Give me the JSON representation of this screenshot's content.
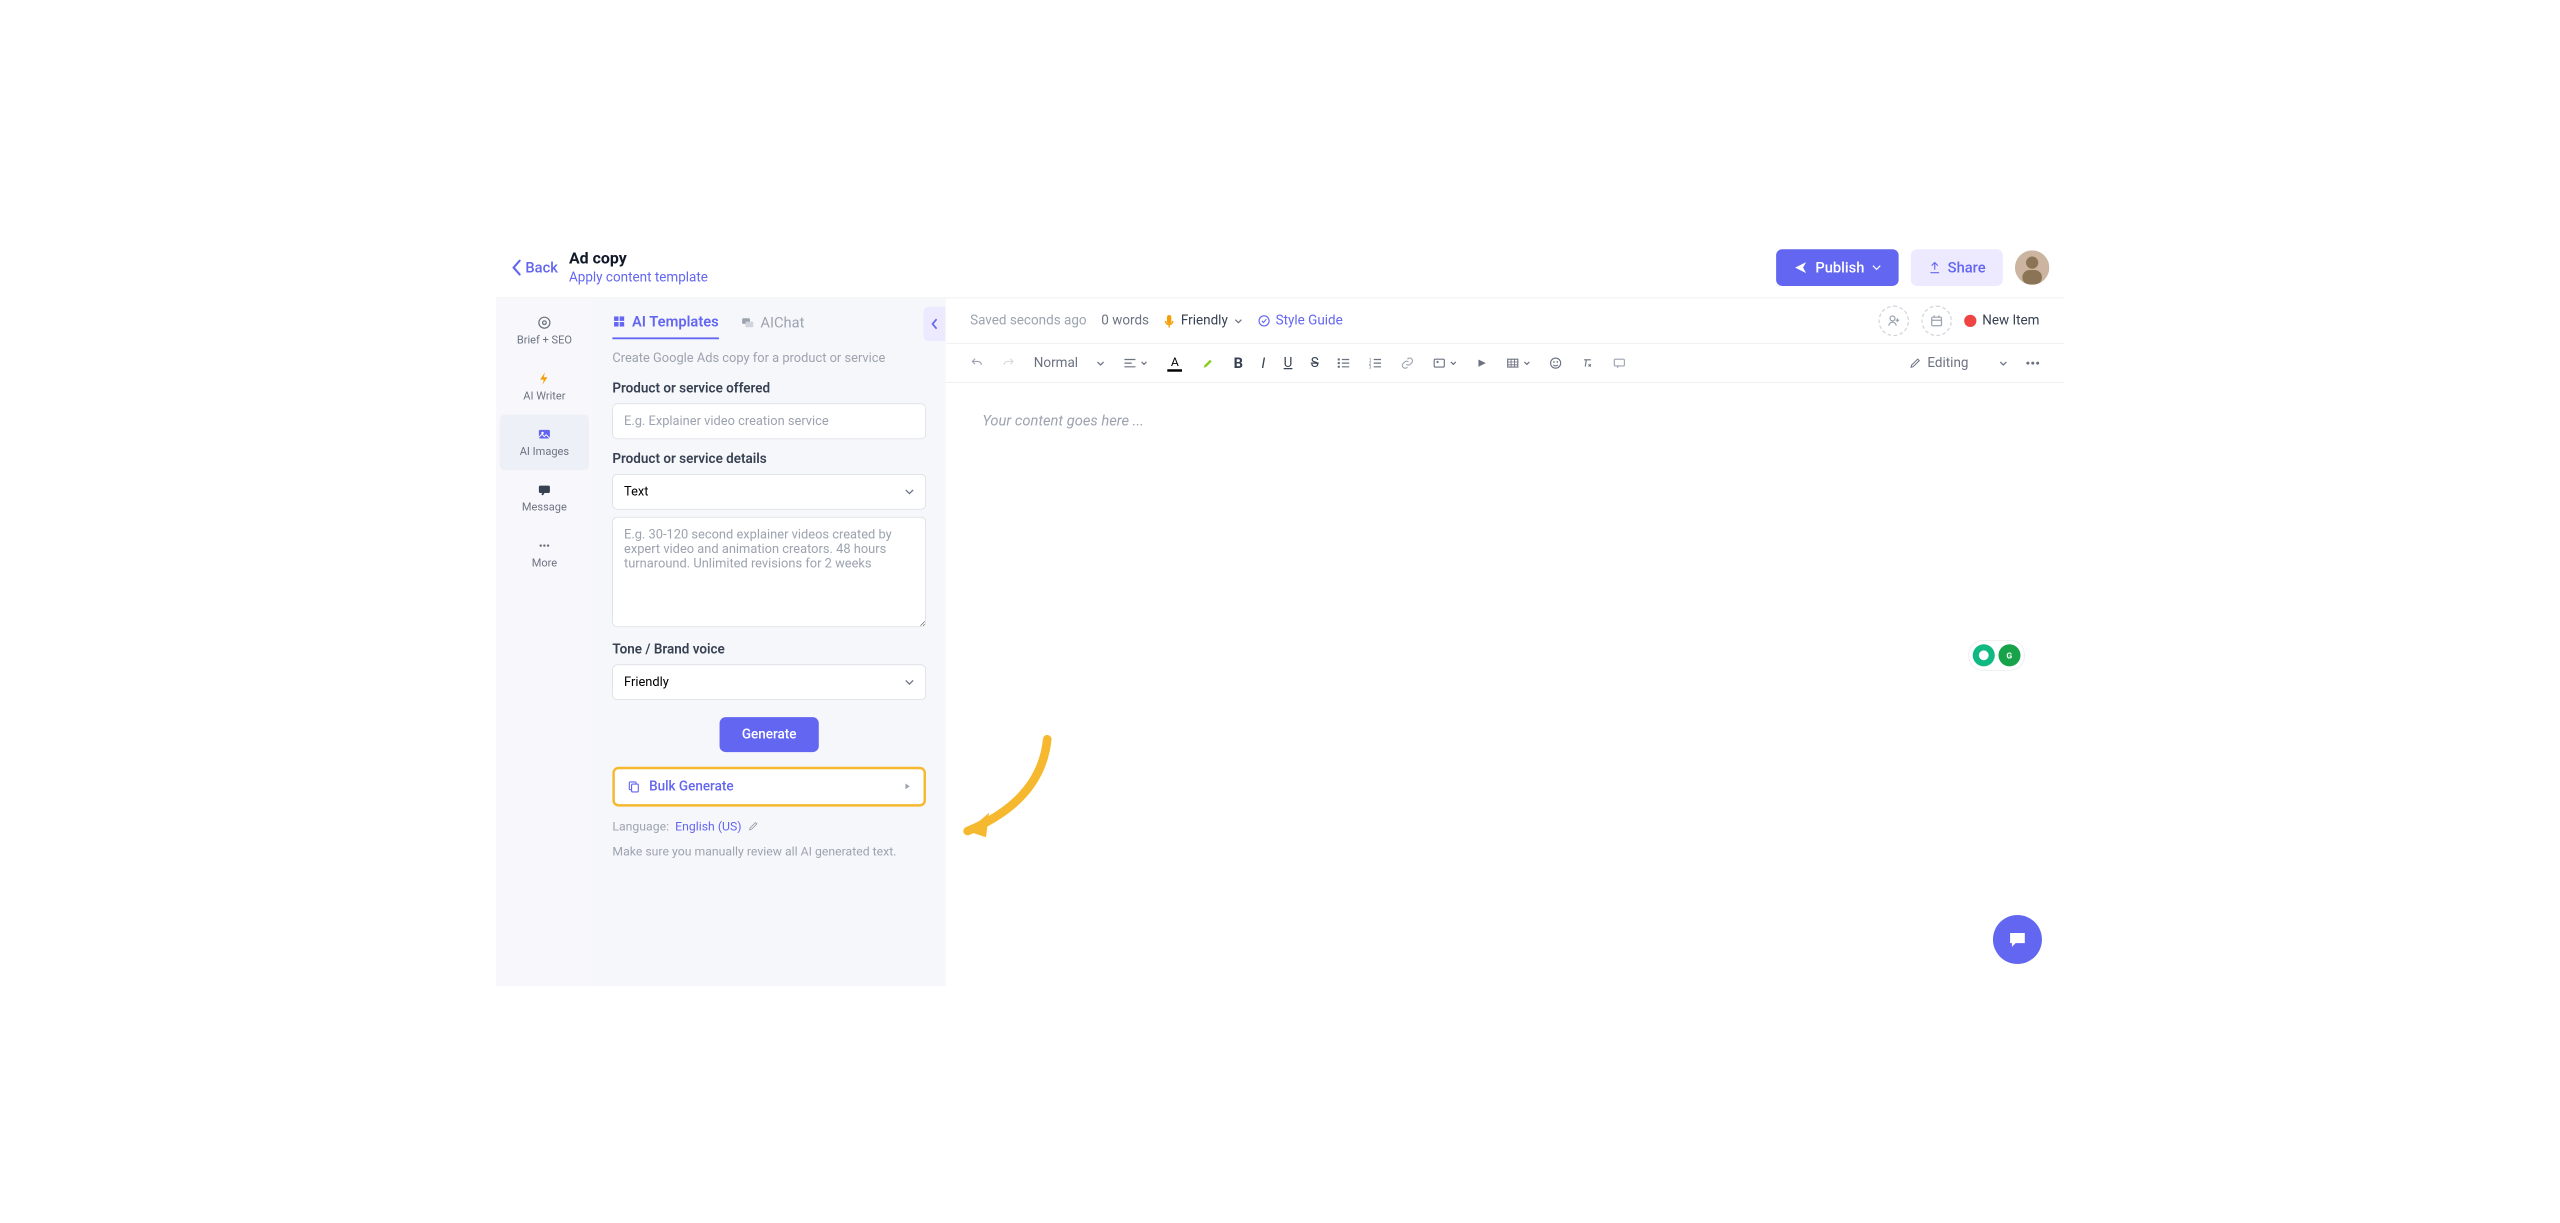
{
  "header": {
    "back": "Back",
    "title": "Ad copy",
    "template_link": "Apply content template",
    "publish": "Publish",
    "share": "Share"
  },
  "sidebar": {
    "items": [
      {
        "label": "Brief + SEO"
      },
      {
        "label": "AI Writer"
      },
      {
        "label": "AI Images"
      },
      {
        "label": "Message"
      },
      {
        "label": "More"
      }
    ]
  },
  "panel": {
    "tabs": {
      "templates": "AI Templates",
      "chat": "AIChat"
    },
    "desc": "Create Google Ads copy for a product or service",
    "f1_label": "Product or service offered",
    "f1_placeholder": "E.g. Explainer video creation service",
    "f2_label": "Product or service details",
    "f2_type": "Text",
    "f2_placeholder": "E.g. 30-120 second explainer videos created by expert video and animation creators. 48 hours turnaround. Unlimited revisions for 2 weeks",
    "f3_label": "Tone / Brand voice",
    "f3_value": "Friendly",
    "generate": "Generate",
    "bulk": "Bulk Generate",
    "lang_label": "Language:",
    "lang_value": "English (US)",
    "note": "Make sure you manually review all AI generated text."
  },
  "editor": {
    "saved": "Saved seconds ago",
    "words": "0 words",
    "tone": "Friendly",
    "style_guide": "Style Guide",
    "new_item": "New Item",
    "normal": "Normal",
    "editing": "Editing",
    "placeholder": "Your content goes here ..."
  }
}
